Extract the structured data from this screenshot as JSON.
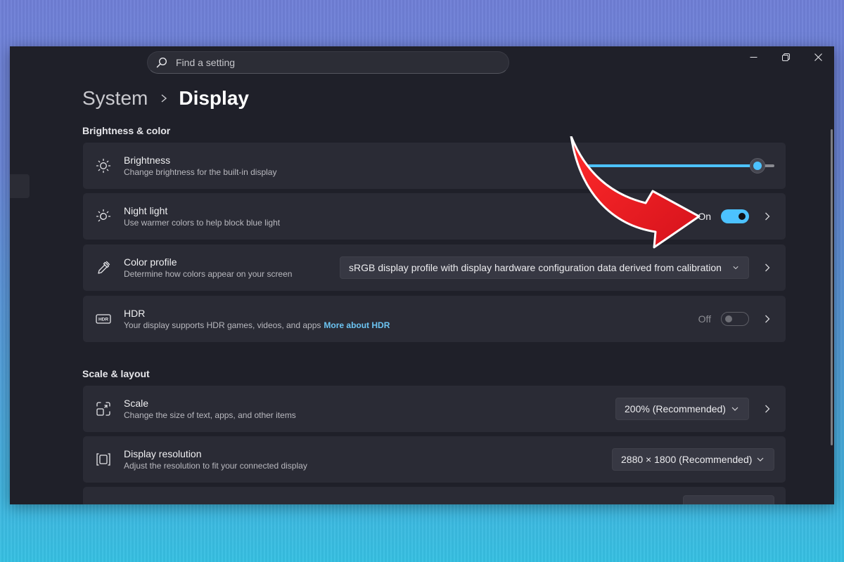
{
  "search": {
    "placeholder": "Find a setting",
    "icon": "search-icon"
  },
  "window_controls": [
    "minimize-icon",
    "restore-icon",
    "close-icon"
  ],
  "breadcrumb": {
    "parent": "System",
    "current": "Display"
  },
  "sections": {
    "brightness_color": {
      "title": "Brightness & color"
    },
    "scale_layout": {
      "title": "Scale & layout"
    }
  },
  "brightness": {
    "title": "Brightness",
    "subtitle": "Change brightness for the built-in display",
    "value_percent": 91,
    "icon": "sun-icon"
  },
  "night_light": {
    "title": "Night light",
    "subtitle": "Use warmer colors to help block blue light",
    "state_label": "On",
    "enabled": true,
    "icon": "night-light-icon"
  },
  "color_profile": {
    "title": "Color profile",
    "subtitle": "Determine how colors appear on your screen",
    "selected": "sRGB display profile with display hardware configuration data derived from calibration",
    "icon": "eyedropper-icon"
  },
  "hdr": {
    "title": "HDR",
    "subtitle": "Your display supports HDR games, videos, and apps",
    "link": "More about HDR",
    "state_label": "Off",
    "enabled": false,
    "icon": "hdr-icon"
  },
  "scale": {
    "title": "Scale",
    "subtitle": "Change the size of text, apps, and other items",
    "selected": "200% (Recommended)",
    "icon": "scale-icon"
  },
  "display_resolution": {
    "title": "Display resolution",
    "subtitle": "Adjust the resolution to fit your connected display",
    "selected": "2880 × 1800 (Recommended)",
    "icon": "resolution-icon"
  },
  "colors": {
    "accent": "#4cc2ff",
    "window_bg": "#1f2029",
    "card_bg": "#2a2b35",
    "annotation_arrow": "#e21a22"
  }
}
